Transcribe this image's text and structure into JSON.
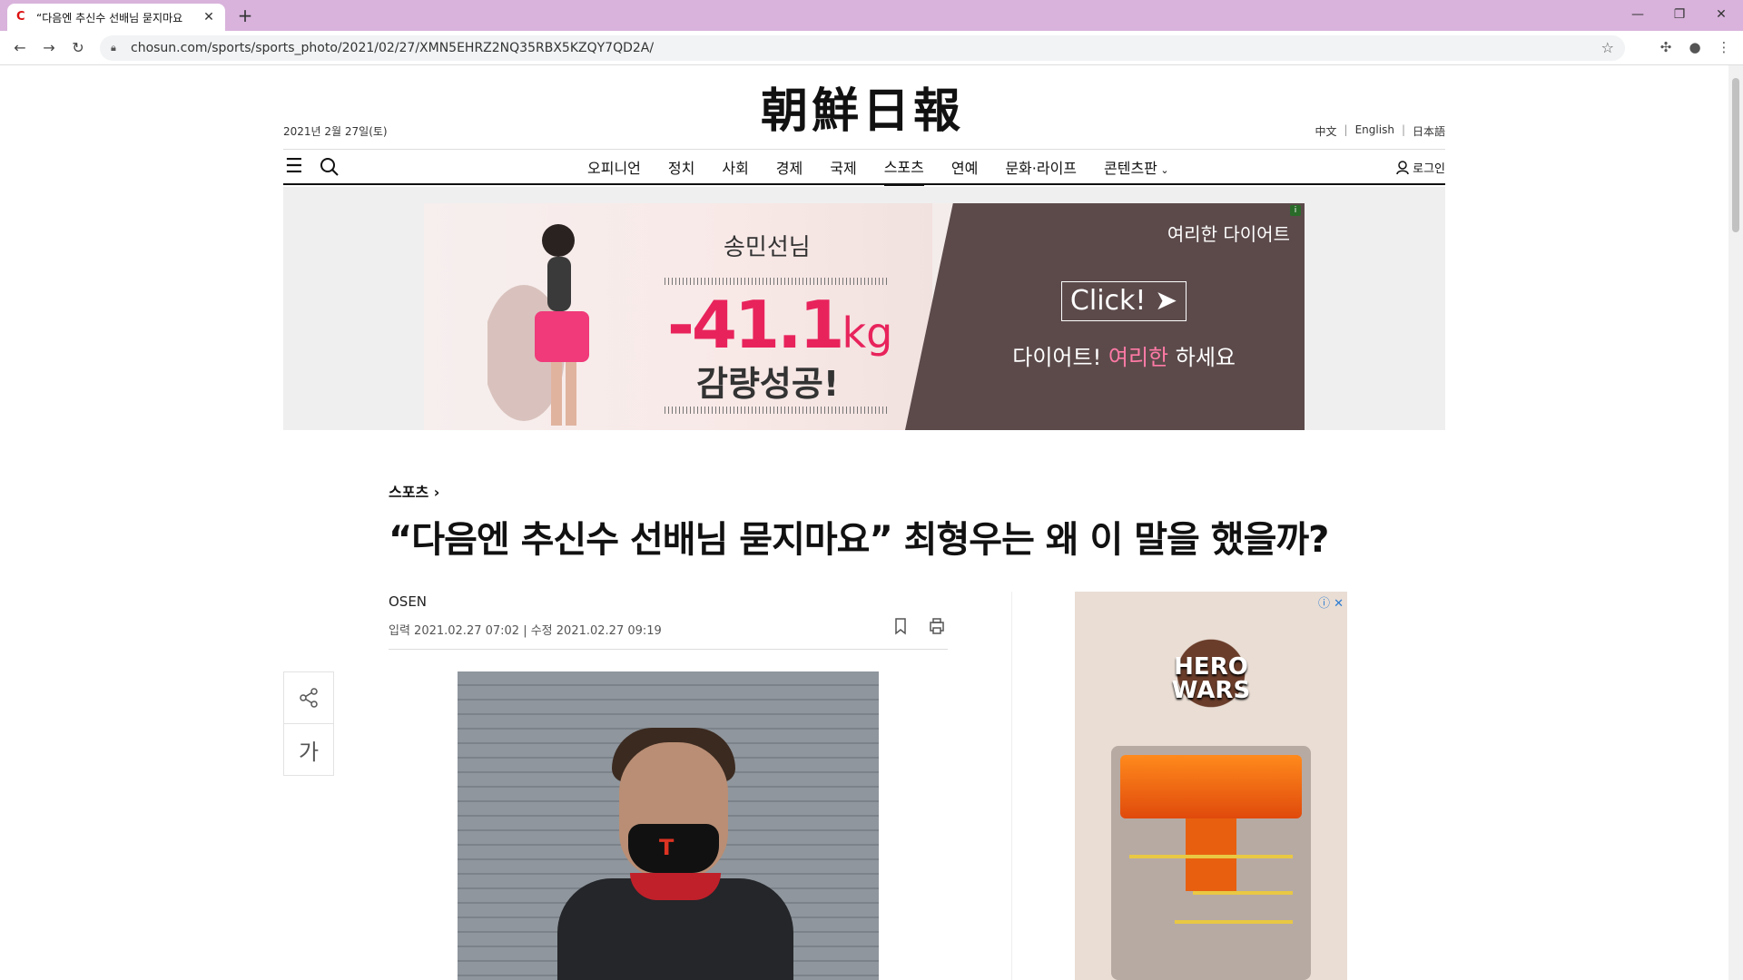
{
  "browser": {
    "tab_title": "“다음엔 추신수 선배님 묻지마요",
    "url": "chosun.com/sports/sports_photo/2021/02/27/XMN5EHRZ2NQ35RBX5KZQY7QD2A/"
  },
  "site": {
    "logo": "朝鮮日報",
    "date": "2021년 2월 27일(토)",
    "languages": [
      "中文",
      "English",
      "日本語"
    ],
    "nav": [
      "오피니언",
      "정치",
      "사회",
      "경제",
      "국제",
      "스포츠",
      "연예",
      "문화·라이프",
      "콘텐츠판"
    ],
    "nav_active": "스포츠",
    "login": "로그인"
  },
  "banner_ad": {
    "name": "송민선님",
    "amount": "-41.1",
    "unit": "kg",
    "result": "감량성공!",
    "brand": "여리한 다이어트",
    "click": "Click! ➤",
    "slogan_pre": "다이어트!",
    "slogan_highlight": "여리한",
    "slogan_post": "하세요"
  },
  "article": {
    "section": "스포츠 ›",
    "headline": "“다음엔 추신수 선배님 묻지마요” 최형우는 왜 이 말을 했을까?",
    "source": "OSEN",
    "dates": "입력 2021.02.27 07:02 | 수정 2021.02.27 09:19",
    "font_button": "가"
  },
  "side_ad": {
    "title_line1": "HERO",
    "title_line2": "WARS"
  },
  "icons": [
    "chosun-favicon",
    "close-icon",
    "plus-icon",
    "back-icon",
    "forward-icon",
    "reload-icon",
    "lock-icon",
    "star-icon",
    "extension-icon",
    "profile-icon",
    "kebab-icon",
    "menu-icon",
    "search-icon",
    "user-icon",
    "bookmark-icon",
    "print-icon",
    "share-icon"
  ]
}
